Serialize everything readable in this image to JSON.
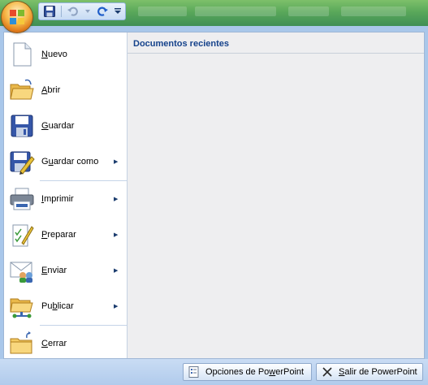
{
  "office_button": {
    "icon": "office-logo-icon"
  },
  "quick_access": {
    "items": [
      {
        "name": "save-icon"
      },
      {
        "name": "undo-icon"
      },
      {
        "name": "redo-icon"
      },
      {
        "name": "customize-dropdown-icon"
      }
    ]
  },
  "menu": {
    "items": [
      {
        "label_pre": "",
        "acc": "N",
        "label_post": "uevo",
        "icon": "new-document-icon",
        "submenu": false
      },
      {
        "label_pre": "",
        "acc": "A",
        "label_post": "brir",
        "icon": "open-folder-icon",
        "submenu": false
      },
      {
        "label_pre": "",
        "acc": "G",
        "label_post": "uardar",
        "icon": "save-disk-icon",
        "submenu": false
      },
      {
        "label_pre": "G",
        "acc": "u",
        "label_post": "ardar como",
        "icon": "save-as-icon",
        "submenu": true
      },
      {
        "label_pre": "",
        "acc": "I",
        "label_post": "mprimir",
        "icon": "printer-icon",
        "submenu": true
      },
      {
        "label_pre": "",
        "acc": "P",
        "label_post": "reparar",
        "icon": "prepare-icon",
        "submenu": true
      },
      {
        "label_pre": "",
        "acc": "E",
        "label_post": "nviar",
        "icon": "send-icon",
        "submenu": true
      },
      {
        "label_pre": "Pu",
        "acc": "b",
        "label_post": "licar",
        "icon": "publish-icon",
        "submenu": true
      },
      {
        "label_pre": "",
        "acc": "C",
        "label_post": "errar",
        "icon": "close-folder-icon",
        "submenu": false
      }
    ]
  },
  "recent": {
    "title": "Documentos recientes"
  },
  "bottom": {
    "options_pre": "Opciones de Po",
    "options_acc": "w",
    "options_post": "erPoint",
    "exit_pre": "",
    "exit_acc": "S",
    "exit_post": "alir de PowerPoint"
  },
  "colors": {
    "accent": "#15428b",
    "menu_border": "#9fb6d5",
    "right_pane": "#eeeef0"
  }
}
